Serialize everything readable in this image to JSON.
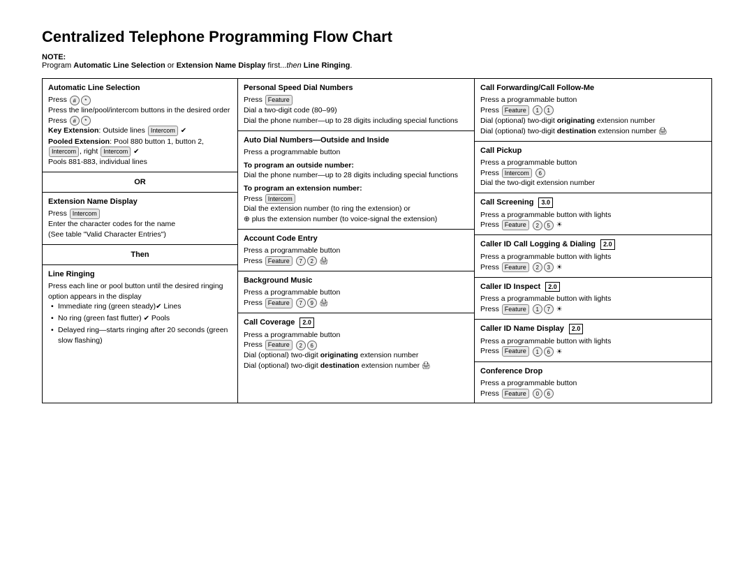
{
  "page": {
    "title": "Centralized Telephone Programming Flow Chart",
    "note_label": "NOTE:",
    "note_text": "Program ",
    "note_bold1": "Automatic Line Selection",
    "note_or": " or ",
    "note_bold2": "Extension Name Display",
    "note_after": " first...",
    "note_then": "then",
    "note_bold3": " Line Ringing",
    "note_period": "."
  },
  "left": {
    "auto_line": {
      "title": "Automatic Line Selection",
      "press1": "Press",
      "btn1": "#",
      "btn2": "*",
      "text1": "Press the line/pool/intercom buttons in the desired order",
      "press2": "Press",
      "btn3": "#",
      "btn4": "*",
      "key_ext_label": "Key Extension",
      "key_ext": ": Outside lines",
      "key_ext_btn": "Intercom",
      "key_checkmark": "✔",
      "pooled_label": "Pooled Extension",
      "pooled": ": Pool 880 button 1, button 2,",
      "pooled_btn1": "Intercom",
      "pooled_comma": ", right",
      "pooled_btn2": "Intercom",
      "pooled_check": "✔",
      "pools": "Pools 881-883, individual lines"
    },
    "or_text": "OR",
    "ext_name": {
      "title": "Extension Name Display",
      "press": "Press",
      "btn": "Intercom",
      "text1": "Enter the character codes for the name",
      "text2": "(See table \"Valid Character Entries\")"
    },
    "then_text": "Then",
    "line_ringing": {
      "title": "Line Ringing",
      "text1": "Press each line or pool button until the desired ringing option appears in the display",
      "bullet1": "Immediate ring (green steady)",
      "check1": "✔",
      "after1": " Lines",
      "bullet2": "No ring (green fast flutter)",
      "check2": "✔",
      "after2": " Pools",
      "bullet3": "Delayed ring—starts ringing after 20 seconds (green slow flashing)"
    }
  },
  "middle": {
    "personal_speed": {
      "title": "Personal Speed Dial Numbers",
      "press": "Press",
      "btn": "Feature",
      "text1": "Dial a two-digit code (80–99)",
      "text2": "Dial the phone number—up to 28 digits including special functions"
    },
    "auto_dial": {
      "title": "Auto Dial Numbers—Outside and Inside",
      "text1": "Press a programmable button",
      "sub1": "To program an outside number:",
      "text2": "Dial the phone number—up to 28 digits including special functions",
      "sub2": "To program an extension number:",
      "press": "Press",
      "btn": "Intercom",
      "text3": "Dial the extension number (to ring the extension) or",
      "text4": "⊕ plus the extension number (to voice-signal the extension)"
    },
    "account_code": {
      "title": "Account Code Entry",
      "text1": "Press a programmable button",
      "press": "Press",
      "btn1": "Feature",
      "btn2": "7",
      "btn3": "2",
      "icon": "printer"
    },
    "background_music": {
      "title": "Background Music",
      "text1": "Press a programmable button",
      "press": "Press",
      "btn1": "Feature",
      "btn2": "7",
      "btn3": "9",
      "icon": "printer"
    },
    "call_coverage": {
      "title": "Call Coverage",
      "version": "2.0",
      "text1": "Press a programmable button",
      "press": "Press",
      "btn1": "Feature",
      "btn2": "2",
      "btn3": "6",
      "text2": "Dial (optional) two-digit ",
      "bold2": "originating",
      "text3": " extension number",
      "text4": "Dial (optional) two-digit ",
      "bold4": "destination",
      "text5": " extension number",
      "icon": "printer"
    }
  },
  "right": {
    "call_forwarding": {
      "title": "Call Forwarding/Call Follow-Me",
      "text1": "Press a programmable button",
      "press": "Press",
      "btn1": "Feature",
      "btn2": "1",
      "btn3": "1",
      "text2": "Dial (optional) two-digit ",
      "bold2": "originating",
      "text3": " extension number",
      "text4": "Dial (optional) two-digit ",
      "bold4": "destination",
      "text5": " extension number",
      "icon": "printer"
    },
    "call_pickup": {
      "title": "Call Pickup",
      "text1": "Press a programmable button",
      "press": "Press",
      "btn1": "Intercom",
      "btn2": "6",
      "text2": "Dial the two-digit extension number"
    },
    "call_screening": {
      "title": "Call Screening",
      "version": "3.0",
      "text1": "Press a programmable button with lights",
      "press": "Press",
      "btn1": "Feature",
      "btn2": "2",
      "btn3": "5",
      "icon": "sun"
    },
    "caller_id_logging": {
      "title": "Caller ID Call Logging & Dialing",
      "version": "2.0",
      "text1": "Press a programmable button with lights",
      "press": "Press",
      "btn1": "Feature",
      "btn2": "2",
      "btn3": "3",
      "icon": "sun"
    },
    "caller_id_inspect": {
      "title": "Caller ID Inspect",
      "version": "2.0",
      "text1": "Press a programmable button with lights",
      "press": "Press",
      "btn1": "Feature",
      "btn2": "1",
      "btn3": "7",
      "icon": "sun"
    },
    "caller_id_name": {
      "title": "Caller ID Name Display",
      "version": "2.0",
      "text1": "Press a programmable button with lights",
      "press": "Press",
      "btn1": "Feature",
      "btn2": "1",
      "btn3": "6",
      "icon": "sun"
    },
    "conference_drop": {
      "title": "Conference Drop",
      "text1": "Press a programmable button",
      "press": "Press",
      "btn1": "Feature",
      "btn2": "0",
      "btn3": "6"
    }
  }
}
